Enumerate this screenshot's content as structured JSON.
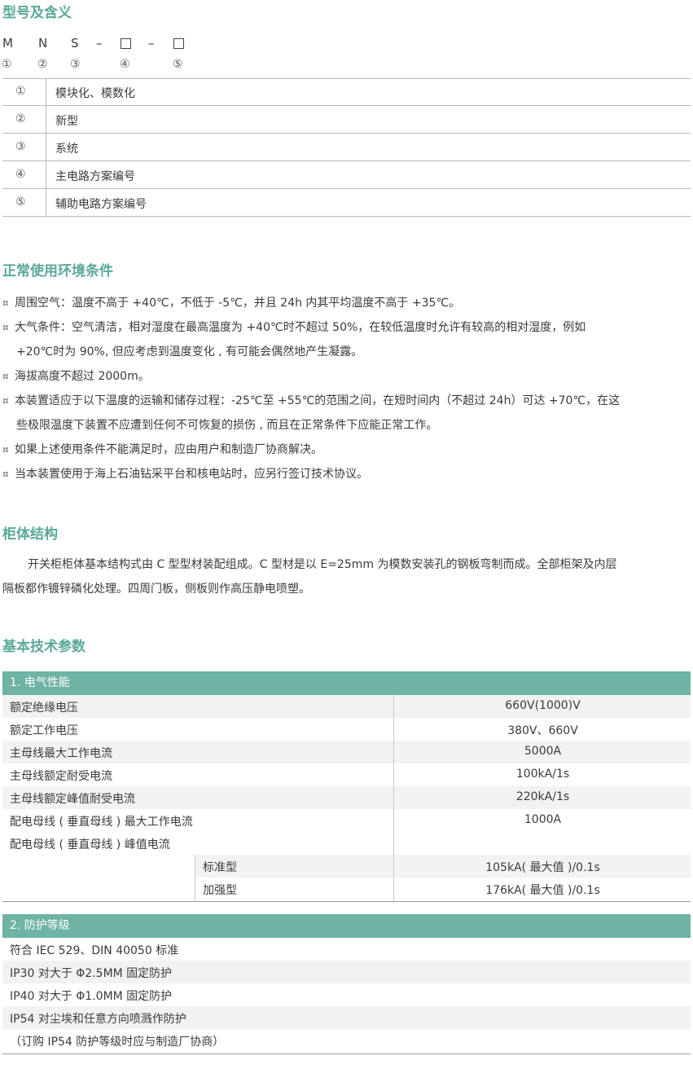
{
  "section1": {
    "title": "型号及含义",
    "code_letters": [
      "M",
      "N",
      "S",
      "–",
      "–"
    ],
    "code_numbers": [
      "①",
      "②",
      "③",
      "④",
      "⑤"
    ],
    "meanings": [
      {
        "num": "①",
        "text": "模块化、模数化"
      },
      {
        "num": "②",
        "text": "新型"
      },
      {
        "num": "③",
        "text": "系统"
      },
      {
        "num": "④",
        "text": "主电路方案编号"
      },
      {
        "num": "⑤",
        "text": "辅助电路方案编号"
      }
    ]
  },
  "section2": {
    "title": "正常使用环境条件",
    "bullet": "¤",
    "items": [
      {
        "line1": "周围空气：温度不高于 +40℃，不低于 -5℃，并且 24h 内其平均温度不高于 +35℃。",
        "line2": ""
      },
      {
        "line1": "大气条件：空气清洁，相对湿度在最高温度为 +40℃时不超过 50%，在较低温度时允许有较高的相对湿度，例如",
        "line2": "+20℃时为 90%, 但应考虑到温度变化 , 有可能会偶然地产生凝露。"
      },
      {
        "line1": "海拔高度不超过 2000m。",
        "line2": ""
      },
      {
        "line1": "本装置适应于以下温度的运输和储存过程：-25℃至 +55℃的范围之间，在短时间内（不超过 24h）可达 +70℃，在这",
        "line2": "些极限温度下装置不应遭到任何不可恢复的损伤 , 而且在正常条件下应能正常工作。"
      },
      {
        "line1": "如果上述使用条件不能满足时，应由用户和制造厂协商解决。",
        "line2": ""
      },
      {
        "line1": "当本装置使用于海上石油钻采平台和核电站时，应另行签订技术协议。",
        "line2": ""
      }
    ]
  },
  "section3": {
    "title": "柜体结构",
    "line1": "开关柜柜体基本结构式由 C 型型材装配组成。C 型材是以 E=25mm 为模数安装孔的钢板弯制而成。全部柜架及内层",
    "line2": "隔板都作镀锌磷化处理。四周门板，侧板则作高压静电喷塑。"
  },
  "section4": {
    "title": "基本技术参数",
    "electrical": {
      "header": "1. 电气性能",
      "rows": [
        {
          "label": "额定绝缘电压",
          "value": "660V(1000)V"
        },
        {
          "label": "额定工作电压",
          "value": "380V、660V"
        },
        {
          "label": "主母线最大工作电流",
          "value": "5000A"
        },
        {
          "label": "主母线额定耐受电流",
          "value": "100kA/1s"
        },
        {
          "label": "主母线额定峰值耐受电流",
          "value": "220kA/1s"
        },
        {
          "label": "配电母线 ( 垂直母线 ) 最大工作电流",
          "value": "1000A"
        },
        {
          "label": "配电母线 ( 垂直母线 ) 峰值电流",
          "value": ""
        }
      ],
      "subrows": [
        {
          "label": "标准型",
          "value": "105kA( 最大值 )/0.1s"
        },
        {
          "label": "加强型",
          "value": "176kA( 最大值 )/0.1s"
        }
      ]
    },
    "protection": {
      "header": "2. 防护等级",
      "rows": [
        "符合 IEC 529、DIN 40050 标准",
        "IP30 对大于 Φ2.5MM 固定防护",
        "IP40 对大于 Φ1.0MM 固定防护",
        "IP54 对尘埃和任意方向喷溅作防护",
        "（订购 IP54 防护等级时应与制造厂协商）"
      ]
    }
  }
}
